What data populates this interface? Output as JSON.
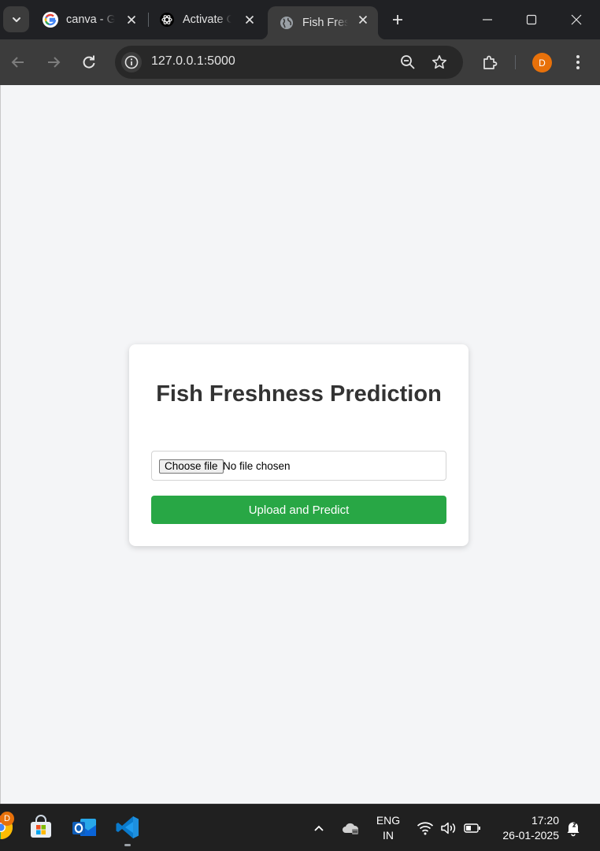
{
  "browser": {
    "tabs": [
      {
        "title": "canva - Google Search",
        "favicon": "google-g-icon",
        "active": false
      },
      {
        "title": "Activate ChatGPT",
        "favicon": "chatgpt-icon",
        "active": false
      },
      {
        "title": "Fish Freshness Prediction",
        "favicon": "globe-icon",
        "active": true
      }
    ],
    "address_bar": {
      "url": "127.0.0.1:5000"
    },
    "profile_initial": "D",
    "accent_color": "#e8710a"
  },
  "page": {
    "heading": "Fish Freshness Prediction",
    "file_input": {
      "button_label": "Choose file",
      "status": "No file chosen"
    },
    "submit_label": "Upload and Predict",
    "submit_color": "#28a745"
  },
  "taskbar": {
    "apps": [
      "chrome-icon",
      "microsoft-store-icon",
      "outlook-icon",
      "vscode-icon"
    ],
    "chrome_badge": "D",
    "language": {
      "line1": "ENG",
      "line2": "IN"
    },
    "time": "17:20",
    "date": "26-01-2025"
  }
}
